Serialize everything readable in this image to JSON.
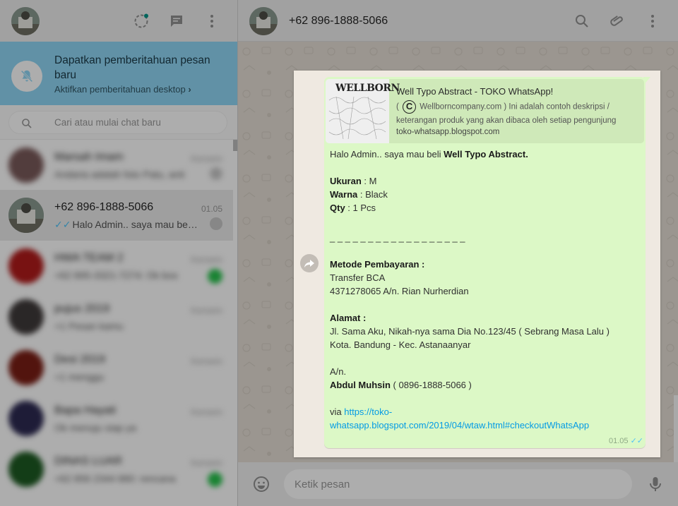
{
  "left_header": {
    "icons": [
      "status-icon",
      "new-chat-icon",
      "menu-icon"
    ]
  },
  "notification": {
    "title": "Dapatkan pemberitahuan pesan baru",
    "subtitle": "Aktifkan pemberitahuan desktop",
    "subtitle_arrow": "›"
  },
  "search": {
    "placeholder": "Cari atau mulai chat baru"
  },
  "chats": [
    {
      "name": "Marsah Imam",
      "time": "Kemarin",
      "preview": "Andaria adalah foto Patu, anti"
    },
    {
      "name": "+62 896-1888-5066",
      "time": "01.05",
      "ticks": "✓✓",
      "preview": "Halo Admin.. saya mau beli ..."
    },
    {
      "name": "HWA TEAM 2",
      "time": "Kemarin",
      "preview": "+62 895-3321-7274: Ok bos"
    },
    {
      "name": "pujus 2019",
      "time": "Kemarin",
      "preview": "+1 Pesan kamu"
    },
    {
      "name": "Desi 2019",
      "time": "Kemarin",
      "preview": "+1 menggu"
    },
    {
      "name": "Bapa Hayati",
      "time": "Kemarin",
      "preview": "Ok menuju siap ya"
    },
    {
      "name": "DINAS LUAR",
      "time": "Kemarin",
      "preview": "+62 856 2344 880: rencana"
    }
  ],
  "right_header": {
    "contact_name": "+62 896-1888-5066",
    "icons": [
      "search-icon",
      "attach-icon",
      "menu-icon"
    ]
  },
  "message": {
    "link_preview": {
      "thumb_text": "WELLBORN",
      "title": "Well Typo Abstract - TOKO WhatsApp!",
      "desc_prefix": "(",
      "desc_copyright": "C",
      "desc": "Wellborncompany.com ) Ini adalah contoh deskripsi / keterangan produk yang akan dibaca oleh setiap pengunjung",
      "url": "toko-whatsapp.blogspot.com"
    },
    "greeting": "Halo Admin.. saya mau beli ",
    "product": "Well Typo Abstract.",
    "size_label": "Ukuran",
    "size_value": " : M",
    "color_label": "Warna",
    "color_value": " : Black",
    "qty_label": "Qty",
    "qty_value": " : 1 Pcs",
    "separator": "_ _ _ _ _ _ _ _ _ _ _ _ _ _ _ _ _ _",
    "payment_label": "Metode Pembayaran :",
    "payment_line1": "Transfer BCA",
    "payment_line2": "4371278065 A/n. Rian Nurherdian",
    "address_label": "Alamat :",
    "address_line1": "Jl. Sama Aku, Nikah-nya sama Dia No.123/45 ( Sebrang Masa Lalu )",
    "address_line2": "Kota. Bandung - Kec. Astanaanyar",
    "an_label": "A/n.",
    "buyer_name": "Abdul Muhsin",
    "buyer_phone": " ( 0896-1888-5066 )",
    "via_label": "via ",
    "via_link_1": "https://toko-",
    "via_link_2": "whatsapp.blogspot.com/2019/04/wtaw.html#checkoutWhatsApp",
    "time": "01.05",
    "ticks": "✓✓"
  },
  "composer": {
    "placeholder": "Ketik pesan"
  },
  "colors": {
    "bubble": "#dcf8c6",
    "notification": "#8fd6f5",
    "link": "#039be5",
    "read_ticks": "#4fc3f7",
    "unread_badge": "#27c24c"
  }
}
